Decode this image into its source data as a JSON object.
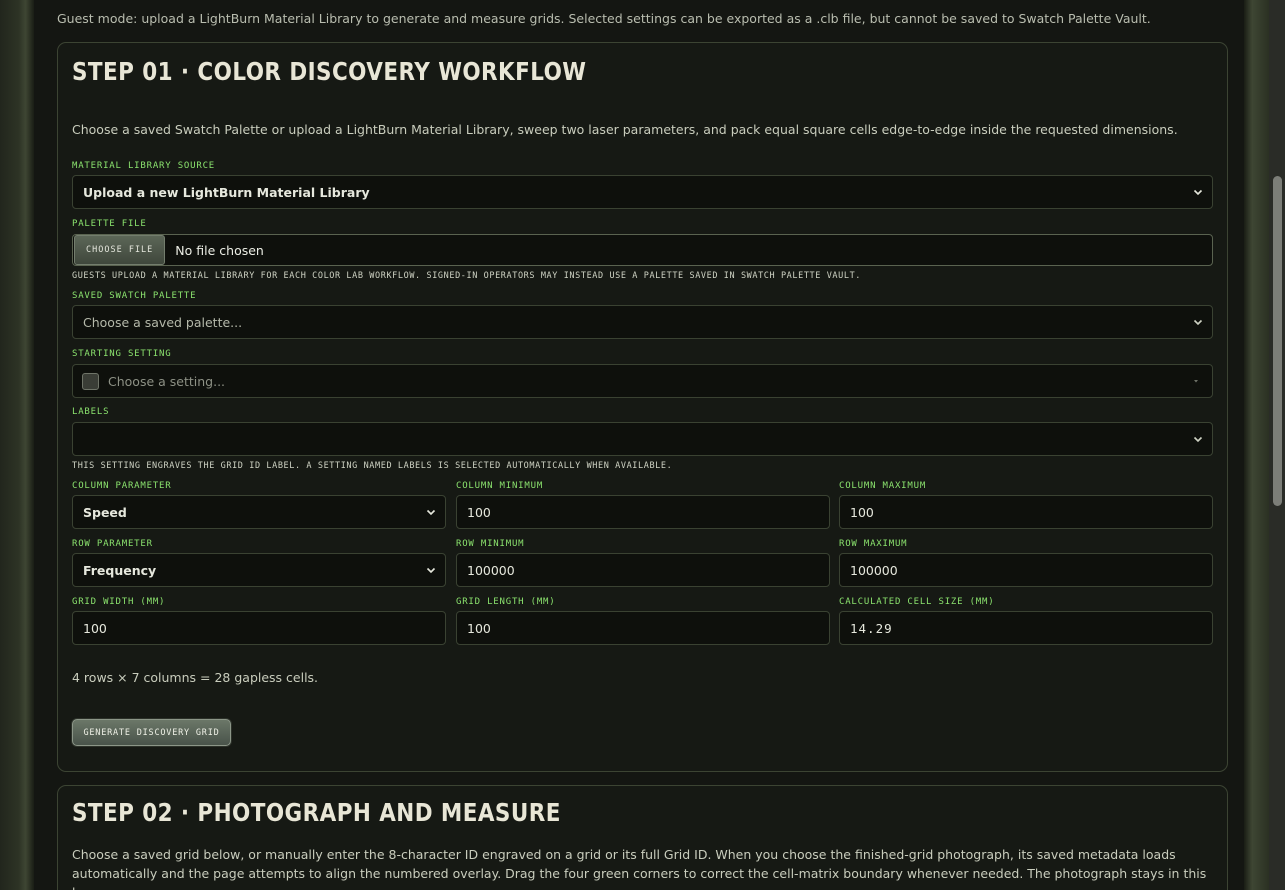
{
  "guest_note": "Guest mode: upload a LightBurn Material Library to generate and measure grids. Selected settings can be exported as a .clb file, but cannot be saved to Swatch Palette Vault.",
  "step1": {
    "title": "STEP 01 · COLOR DISCOVERY WORKFLOW",
    "intro": "Choose a saved Swatch Palette or upload a LightBurn Material Library, sweep two laser parameters, and pack equal square cells edge-to-edge inside the requested dimensions.",
    "source_label": "MATERIAL LIBRARY SOURCE",
    "source_value": "Upload a new LightBurn Material Library",
    "palette_file_label": "PALETTE FILE",
    "choose_file_label": "CHOOSE FILE",
    "file_status": "No file chosen",
    "guest_hint": "GUESTS UPLOAD A MATERIAL LIBRARY FOR EACH COLOR LAB WORKFLOW. SIGNED-IN OPERATORS MAY INSTEAD USE A PALETTE SAVED IN SWATCH PALETTE VAULT.",
    "saved_palette_label": "SAVED SWATCH PALETTE",
    "saved_palette_placeholder": "Choose a saved palette...",
    "starting_setting_label": "STARTING SETTING",
    "starting_setting_placeholder": "Choose a setting...",
    "labels_label": "LABELS",
    "labels_value": "",
    "labels_hint": "THIS SETTING ENGRAVES THE GRID ID LABEL. A SETTING NAMED LABELS IS SELECTED AUTOMATICALLY WHEN AVAILABLE.",
    "column_parameter_label": "COLUMN PARAMETER",
    "column_parameter_value": "Speed",
    "column_min_label": "COLUMN MINIMUM",
    "column_min_value": "100",
    "column_max_label": "COLUMN MAXIMUM",
    "column_max_value": "100",
    "row_parameter_label": "ROW PARAMETER",
    "row_parameter_value": "Frequency",
    "row_min_label": "ROW MINIMUM",
    "row_min_value": "100000",
    "row_max_label": "ROW MAXIMUM",
    "row_max_value": "100000",
    "grid_width_label": "GRID WIDTH (MM)",
    "grid_width_value": "100",
    "grid_length_label": "GRID LENGTH (MM)",
    "grid_length_value": "100",
    "cell_size_label": "CALCULATED CELL SIZE (MM)",
    "cell_size_value": "14.29",
    "summary": "4 rows × 7 columns = 28 gapless cells.",
    "generate_label": "GENERATE DISCOVERY GRID"
  },
  "step2": {
    "title": "STEP 02 · PHOTOGRAPH AND MEASURE",
    "intro": "Choose a saved grid below, or manually enter the 8-character ID engraved on a grid or its full Grid ID. When you choose the finished-grid photograph, its saved metadata loads automatically and the page attempts to align the numbered overlay. Drag the four green corners to correct the cell-matrix boundary whenever needed. The photograph stays in this browser."
  },
  "icons": {
    "select_arrow": "chevron-down-icon",
    "starting_setting_arrow": "caret-down-icon"
  }
}
